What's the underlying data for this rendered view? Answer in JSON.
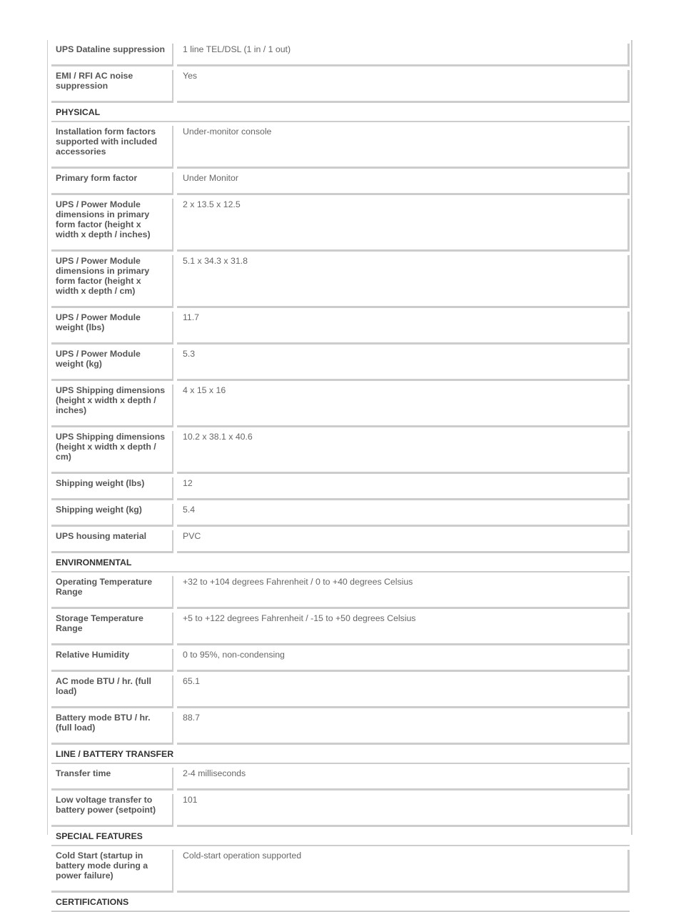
{
  "rows": [
    {
      "type": "spec",
      "label": "UPS Dataline suppression",
      "value": "1 line TEL/DSL (1 in / 1 out)",
      "h": 22
    },
    {
      "type": "spec",
      "label": "EMI / RFI AC noise suppression",
      "value": "Yes",
      "h": 36
    },
    {
      "type": "section",
      "label": "PHYSICAL"
    },
    {
      "type": "spec",
      "label": "Installation form factors supported with included accessories",
      "value": "Under-monitor console",
      "h": 50
    },
    {
      "type": "spec",
      "label": "Primary form factor",
      "value": "Under Monitor",
      "h": 22
    },
    {
      "type": "spec",
      "label": "UPS / Power Module dimensions in primary form factor (height x width x depth / inches)",
      "value": "2 x 13.5 x 12.5",
      "h": 64
    },
    {
      "type": "spec",
      "label": "UPS / Power Module dimensions in primary form factor (height x width x depth / cm)",
      "value": "5.1 x 34.3 x 31.8",
      "h": 64
    },
    {
      "type": "spec",
      "label": "UPS / Power Module weight (lbs)",
      "value": "11.7",
      "h": 36
    },
    {
      "type": "spec",
      "label": "UPS / Power Module weight (kg)",
      "value": "5.3",
      "h": 36
    },
    {
      "type": "spec",
      "label": "UPS Shipping dimensions (height x width x depth / inches)",
      "value": "4 x 15 x 16",
      "h": 50
    },
    {
      "type": "spec",
      "label": "UPS Shipping dimensions (height x width x depth / cm)",
      "value": "10.2 x 38.1 x 40.6",
      "h": 50
    },
    {
      "type": "spec",
      "label": "Shipping weight (lbs)",
      "value": "12",
      "h": 22
    },
    {
      "type": "spec",
      "label": "Shipping weight (kg)",
      "value": "5.4",
      "h": 22
    },
    {
      "type": "spec",
      "label": "UPS housing material",
      "value": "PVC",
      "h": 22
    },
    {
      "type": "section",
      "label": "ENVIRONMENTAL"
    },
    {
      "type": "spec",
      "label": "Operating Temperature Range",
      "value": "+32 to +104 degrees Fahrenheit / 0 to +40 degrees Celsius",
      "h": 36
    },
    {
      "type": "spec",
      "label": "Storage Temperature Range",
      "value": "+5 to +122 degrees Fahrenheit / -15 to +50 degrees Celsius",
      "h": 36
    },
    {
      "type": "spec",
      "label": "Relative Humidity",
      "value": "0 to 95%, non-condensing",
      "h": 22
    },
    {
      "type": "spec",
      "label": "AC mode BTU / hr. (full load)",
      "value": "65.1",
      "h": 36
    },
    {
      "type": "spec",
      "label": "Battery mode BTU / hr. (full load)",
      "value": "88.7",
      "h": 36
    },
    {
      "type": "section",
      "label": "LINE / BATTERY TRANSFER"
    },
    {
      "type": "spec",
      "label": "Transfer time",
      "value": "2-4 milliseconds",
      "h": 22
    },
    {
      "type": "spec",
      "label": "Low voltage transfer to battery power (setpoint)",
      "value": "101",
      "h": 36
    },
    {
      "type": "section",
      "label": "SPECIAL FEATURES"
    },
    {
      "type": "spec",
      "label": "Cold Start (startup in battery mode during a power failure)",
      "value": "Cold-start operation supported",
      "h": 50
    },
    {
      "type": "section",
      "label": "CERTIFICATIONS"
    }
  ]
}
